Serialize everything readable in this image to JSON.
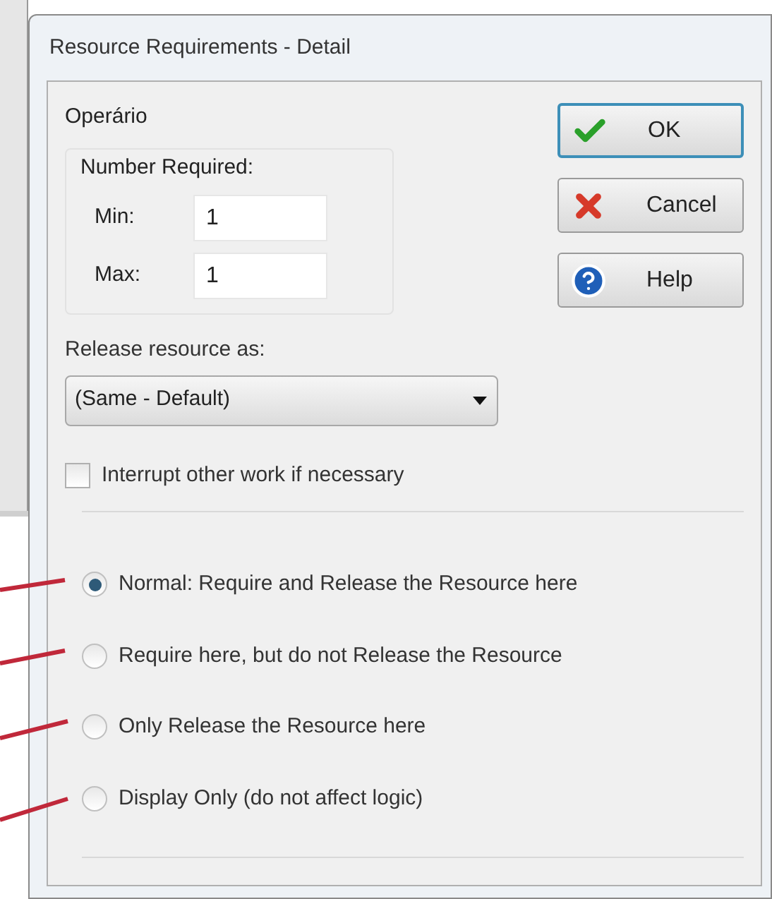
{
  "window": {
    "title": "Resource Requirements - Detail"
  },
  "resource": {
    "label": "Operário"
  },
  "number_required": {
    "label": "Number Required:",
    "min": {
      "label": "Min:",
      "value": "1"
    },
    "max": {
      "label": "Max:",
      "value": "1"
    }
  },
  "release": {
    "label": "Release resource as:",
    "value": "(Same - Default)"
  },
  "interrupt": {
    "label": "Interrupt other work if necessary",
    "checked": false
  },
  "modes": [
    {
      "label": "Normal: Require and Release the Resource here",
      "selected": true
    },
    {
      "label": "Require here, but do not Release the Resource",
      "selected": false
    },
    {
      "label": "Only Release the Resource here",
      "selected": false
    },
    {
      "label": "Display Only (do not affect logic)",
      "selected": false
    }
  ],
  "buttons": [
    {
      "kind": "ok",
      "label": "OK"
    },
    {
      "kind": "cancel",
      "label": "Cancel"
    },
    {
      "kind": "help",
      "label": "Help"
    }
  ]
}
